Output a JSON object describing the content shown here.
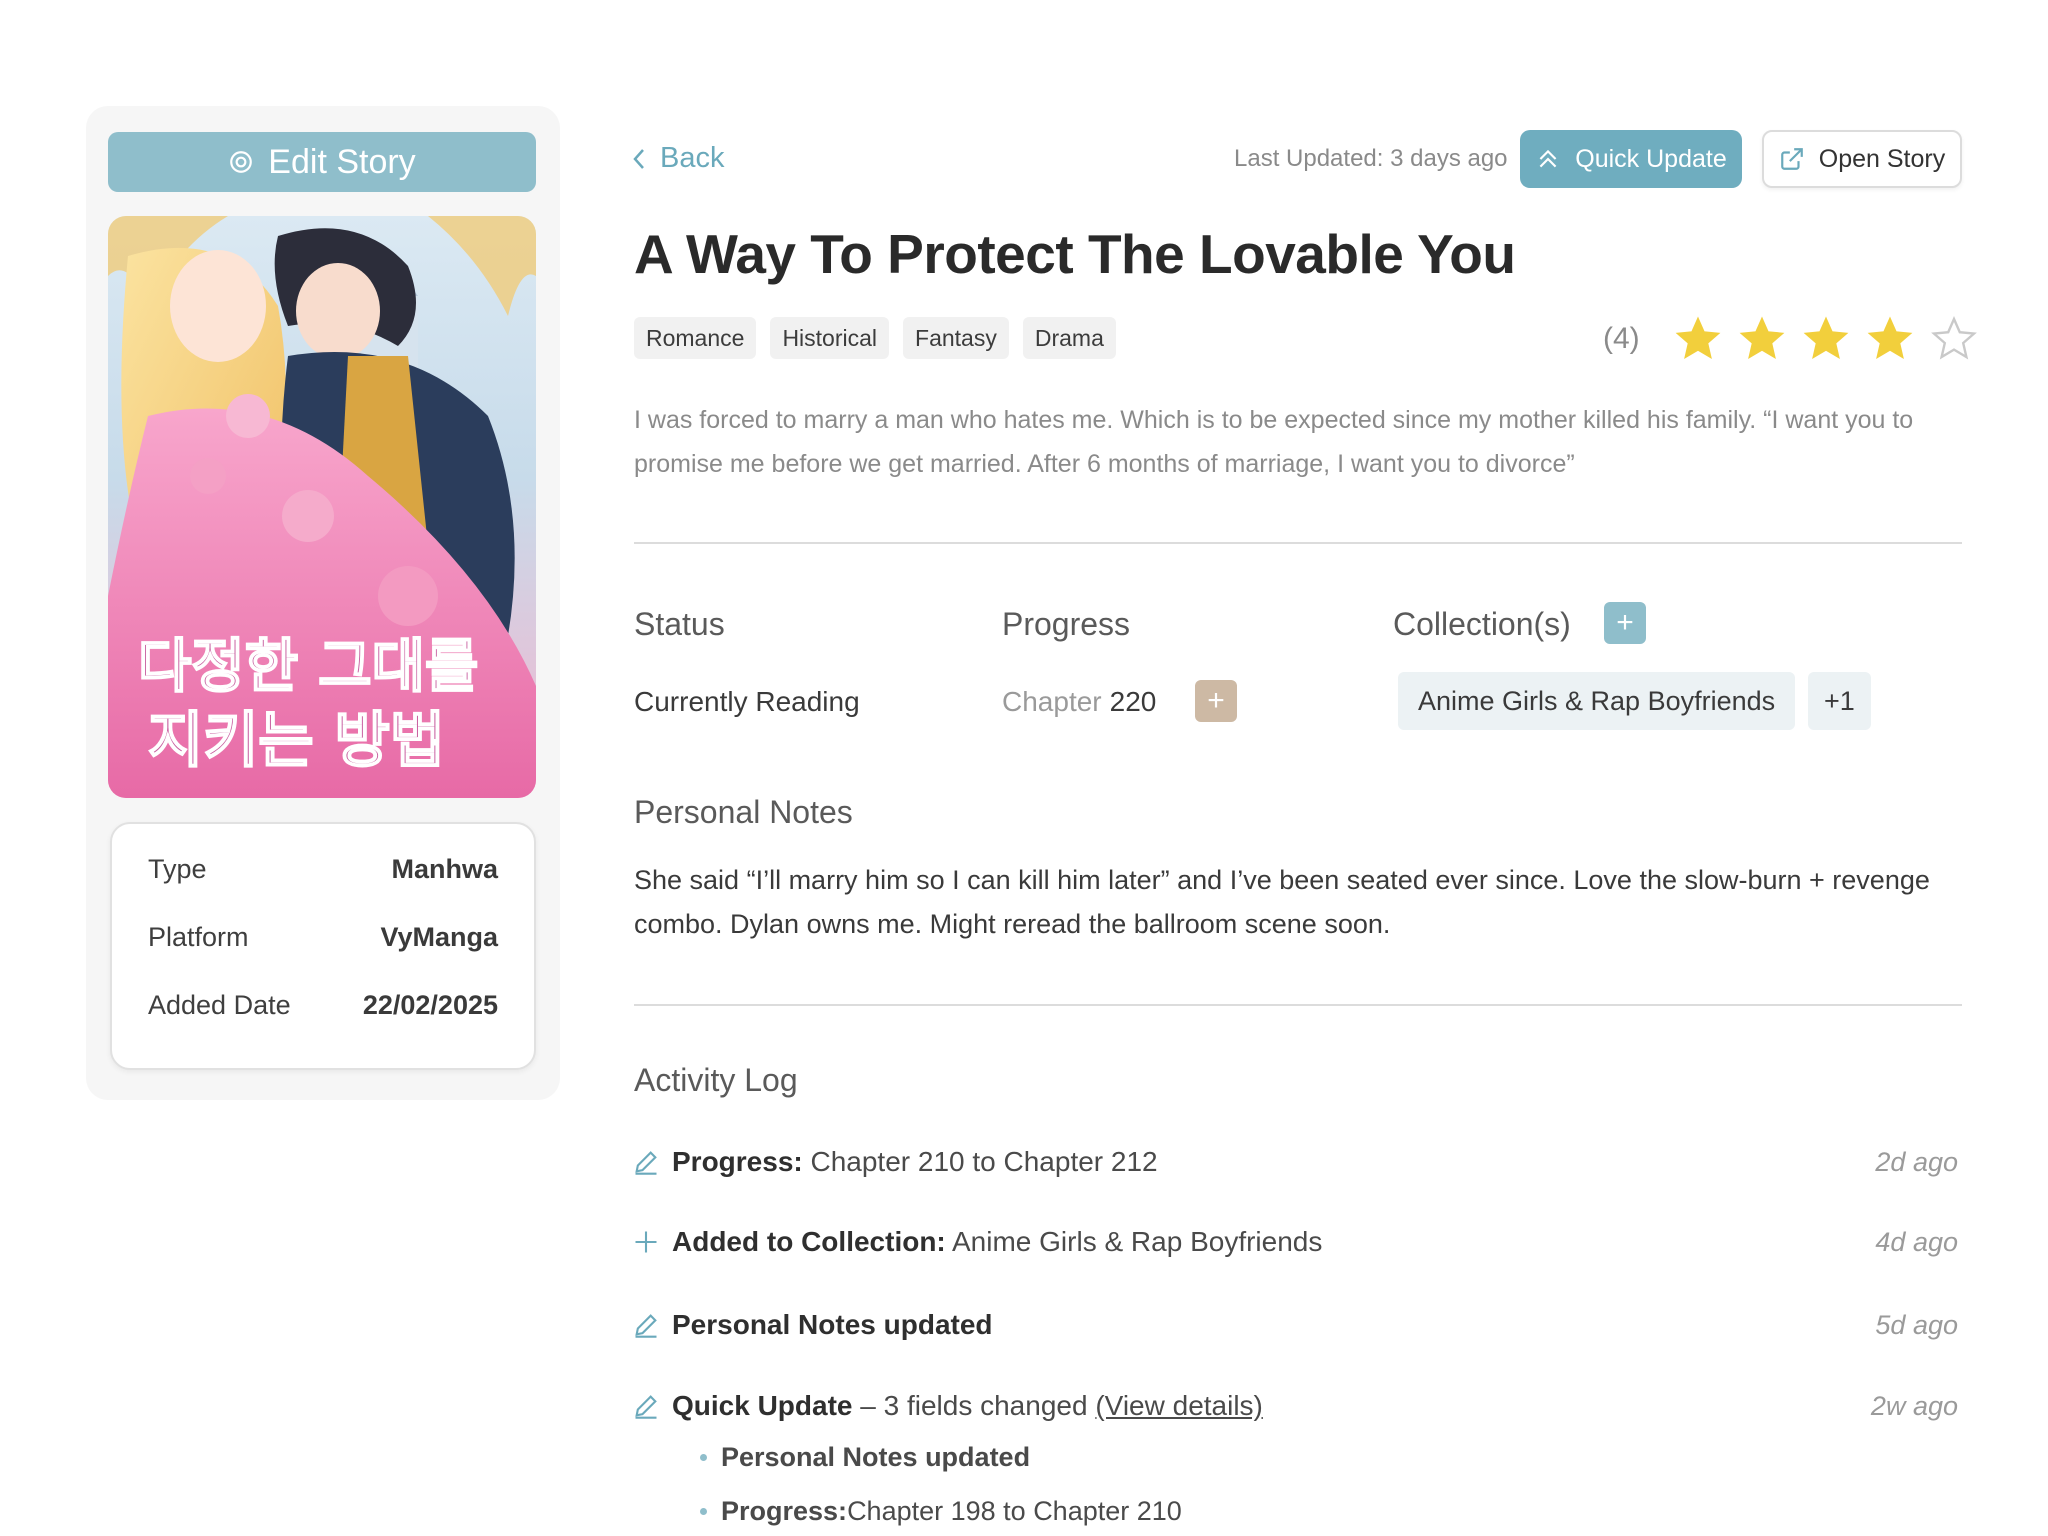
{
  "sidebar": {
    "edit_label": "Edit Story",
    "meta": [
      {
        "key": "Type",
        "value": "Manhwa"
      },
      {
        "key": "Platform",
        "value": "VyManga"
      },
      {
        "key": "Added Date",
        "value": "22/02/2025"
      }
    ]
  },
  "header": {
    "back_label": "Back",
    "last_updated": "Last Updated: 3 days ago",
    "quick_update_label": "Quick Update",
    "open_story_label": "Open Story"
  },
  "story": {
    "title": "A Way To Protect The Lovable You",
    "tags": [
      "Romance",
      "Historical",
      "Fantasy",
      "Drama"
    ],
    "rating_count": "(4)",
    "rating": 4,
    "rating_max": 5,
    "synopsis": "I was forced to marry a man who hates me. Which is to be expected since my mother killed his family. “I want you to promise me before we get married. After 6 months of marriage, I want you to divorce”"
  },
  "details": {
    "status_label": "Status",
    "status_value": "Currently Reading",
    "progress_label": "Progress",
    "chapter_label": "Chapter",
    "chapter_value": "220",
    "collections_label": "Collection(s)",
    "collection_name": "Anime Girls & Rap Boyfriends",
    "collection_more": "+1"
  },
  "notes": {
    "label": "Personal Notes",
    "text": "She said “I’ll marry him so I can kill him later” and I’ve been seated ever since. Love the slow-burn + revenge combo. Dylan owns me. Might reread the ballroom scene soon."
  },
  "activity": {
    "label": "Activity Log",
    "entries": [
      {
        "icon": "pencil-icon",
        "bold": "Progress:",
        "text": " Chapter 210 to Chapter 212",
        "time": "2d ago"
      },
      {
        "icon": "plus-icon",
        "bold": "Added to Collection:",
        "text": " Anime Girls & Rap Boyfriends",
        "time": "4d ago"
      },
      {
        "icon": "pencil-icon",
        "bold": "Personal Notes updated",
        "text": "",
        "time": "5d ago"
      },
      {
        "icon": "pencil-icon",
        "bold": "Quick Update",
        "text": " – 3 fields changed ",
        "link": "(View details)",
        "time": "2w ago"
      }
    ],
    "sub_entries": [
      {
        "bold": "Personal Notes updated",
        "text": ""
      },
      {
        "bold": "Progress:",
        "text": " Chapter 198 to Chapter 210"
      }
    ]
  },
  "colors": {
    "accent": "#8fbecb",
    "accent_dark": "#6fadbf",
    "star": "#f2cf3c",
    "tan": "#cdb9a4"
  }
}
